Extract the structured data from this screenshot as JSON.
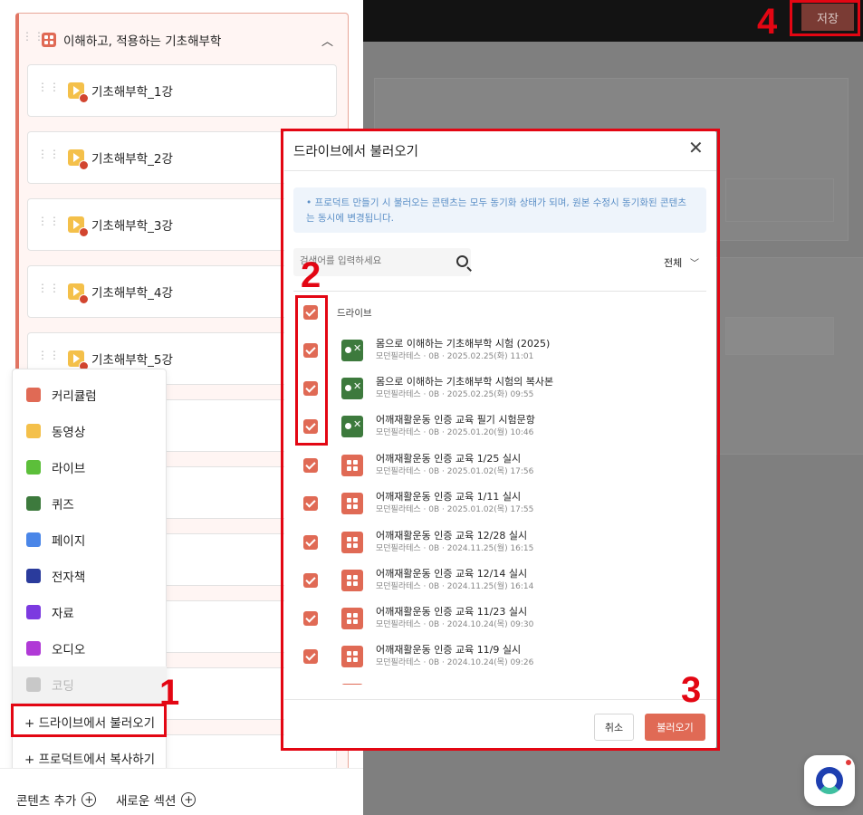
{
  "topbar": {
    "save_label": "저장"
  },
  "section": {
    "title": "이해하고, 적용하는 기초해부학"
  },
  "lessons": [
    {
      "label": "기초해부학_1강"
    },
    {
      "label": "기초해부학_2강"
    },
    {
      "label": "기초해부학_3강"
    },
    {
      "label": "기초해부학_4강"
    },
    {
      "label": "기초해부학_5강"
    }
  ],
  "add_menu": {
    "items": [
      {
        "label": "커리큘럼",
        "icon": "curriculum-icon",
        "color": "#e06a55"
      },
      {
        "label": "동영상",
        "icon": "video-icon",
        "color": "#f4c04a"
      },
      {
        "label": "라이브",
        "icon": "live-icon",
        "color": "#5cbf3a"
      },
      {
        "label": "퀴즈",
        "icon": "quiz-icon",
        "color": "#3d7a3d"
      },
      {
        "label": "페이지",
        "icon": "page-icon",
        "color": "#4a86e8"
      },
      {
        "label": "전자책",
        "icon": "ebook-icon",
        "color": "#2a3b9c"
      },
      {
        "label": "자료",
        "icon": "file-icon",
        "color": "#7c3ae0"
      },
      {
        "label": "오디오",
        "icon": "audio-icon",
        "color": "#b03ad6"
      },
      {
        "label": "코딩",
        "icon": "coding-icon",
        "color": "#c8c8c8"
      }
    ],
    "import_drive": "+ 드라이브에서 불러오기",
    "copy_product": "+ 프로덕트에서 복사하기"
  },
  "bottom": {
    "add_content": "콘텐츠 추가",
    "new_section": "새로운 섹션"
  },
  "modal": {
    "title": "드라이브에서 불러오기",
    "notice": "• 프로덕트 만들기 시 불러오는 콘텐츠는 모두 동기화 상태가 되며, 원본 수정시 동기화된 콘텐츠는 동시에 변경됩니다.",
    "search_placeholder": "검색어를 입력하세요",
    "filter": "전체",
    "header_label": "드라이브",
    "files": [
      {
        "type": "quiz",
        "title": "몸으로 이해하는 기초해부학 시험 (2025)",
        "meta": "모던필라테스 · 0B · 2025.02.25(화) 11:01"
      },
      {
        "type": "quiz",
        "title": "몸으로 이해하는 기초해부학 시험의 복사본",
        "meta": "모던필라테스 · 0B · 2025.02.25(화) 09:55"
      },
      {
        "type": "quiz",
        "title": "어깨재활운동 인증 교육 필기 시험문항",
        "meta": "모던필라테스 · 0B · 2025.01.20(월) 10:46"
      },
      {
        "type": "curriculum",
        "title": "어깨재활운동 인증 교육 1/25 실시",
        "meta": "모던필라테스 · 0B · 2025.01.02(목) 17:56"
      },
      {
        "type": "curriculum",
        "title": "어깨재활운동 인증 교육 1/11 실시",
        "meta": "모던필라테스 · 0B · 2025.01.02(목) 17:55"
      },
      {
        "type": "curriculum",
        "title": "어깨재활운동 인증 교육 12/28 실시",
        "meta": "모던필라테스 · 0B · 2024.11.25(월) 16:15"
      },
      {
        "type": "curriculum",
        "title": "어깨재활운동 인증 교육 12/14 실시",
        "meta": "모던필라테스 · 0B · 2024.11.25(월) 16:14"
      },
      {
        "type": "curriculum",
        "title": "어깨재활운동 인증 교육 11/23 실시",
        "meta": "모던필라테스 · 0B · 2024.10.24(목) 09:30"
      },
      {
        "type": "curriculum",
        "title": "어깨재활운동 인증 교육 11/9 실시",
        "meta": "모던필라테스 · 0B · 2024.10.24(목) 09:26"
      }
    ],
    "cancel_label": "취소",
    "load_label": "불러오기"
  },
  "annotations": {
    "n1": "1",
    "n2": "2",
    "n3": "3",
    "n4": "4",
    "color": "#e30613"
  },
  "accent_color": "#e06a55"
}
